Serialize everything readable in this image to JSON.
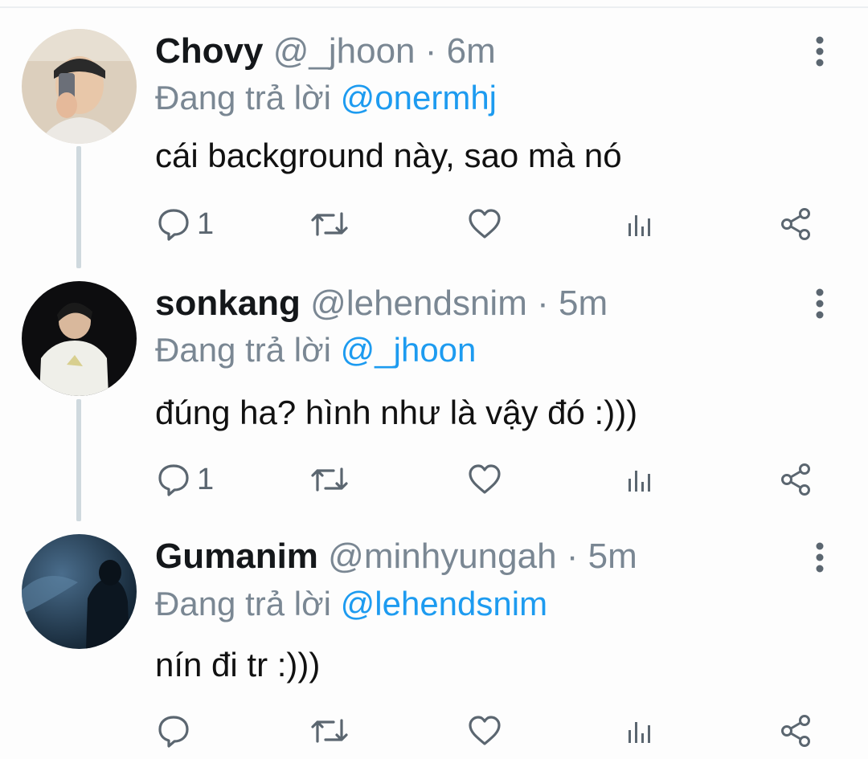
{
  "tweets": [
    {
      "name": "Chovy",
      "handle": "@_jhoon",
      "time": "6m",
      "replying_prefix": "Đang trả lời",
      "replying_to": "@onermhj",
      "text": "cái background này, sao mà nó",
      "reply_count": "1",
      "avatar_color": "#d8cbb8"
    },
    {
      "name": "sonkang",
      "handle": "@lehendsnim",
      "time": "5m",
      "replying_prefix": "Đang trả lời",
      "replying_to": "@_jhoon",
      "text": "đúng ha? hình như là vậy đó :)))",
      "reply_count": "1",
      "avatar_color": "#111111"
    },
    {
      "name": "Gumanim",
      "handle": "@minhyungah",
      "time": "5m",
      "replying_prefix": "Đang trả lời",
      "replying_to": "@lehendsnim",
      "text": "nín đi tr :)))",
      "reply_count": "",
      "avatar_color": "#23405a"
    }
  ],
  "separator": "·",
  "icons": {
    "reply": "speech-bubble-icon",
    "retweet": "retweet-arrows-icon",
    "like": "heart-icon",
    "analytics": "bar-chart-icon",
    "share": "share-nodes-icon",
    "more": "vertical-dots-icon"
  },
  "colors": {
    "mention": "#1d9bf0",
    "muted": "#7a8793",
    "icon": "#5b6670"
  }
}
